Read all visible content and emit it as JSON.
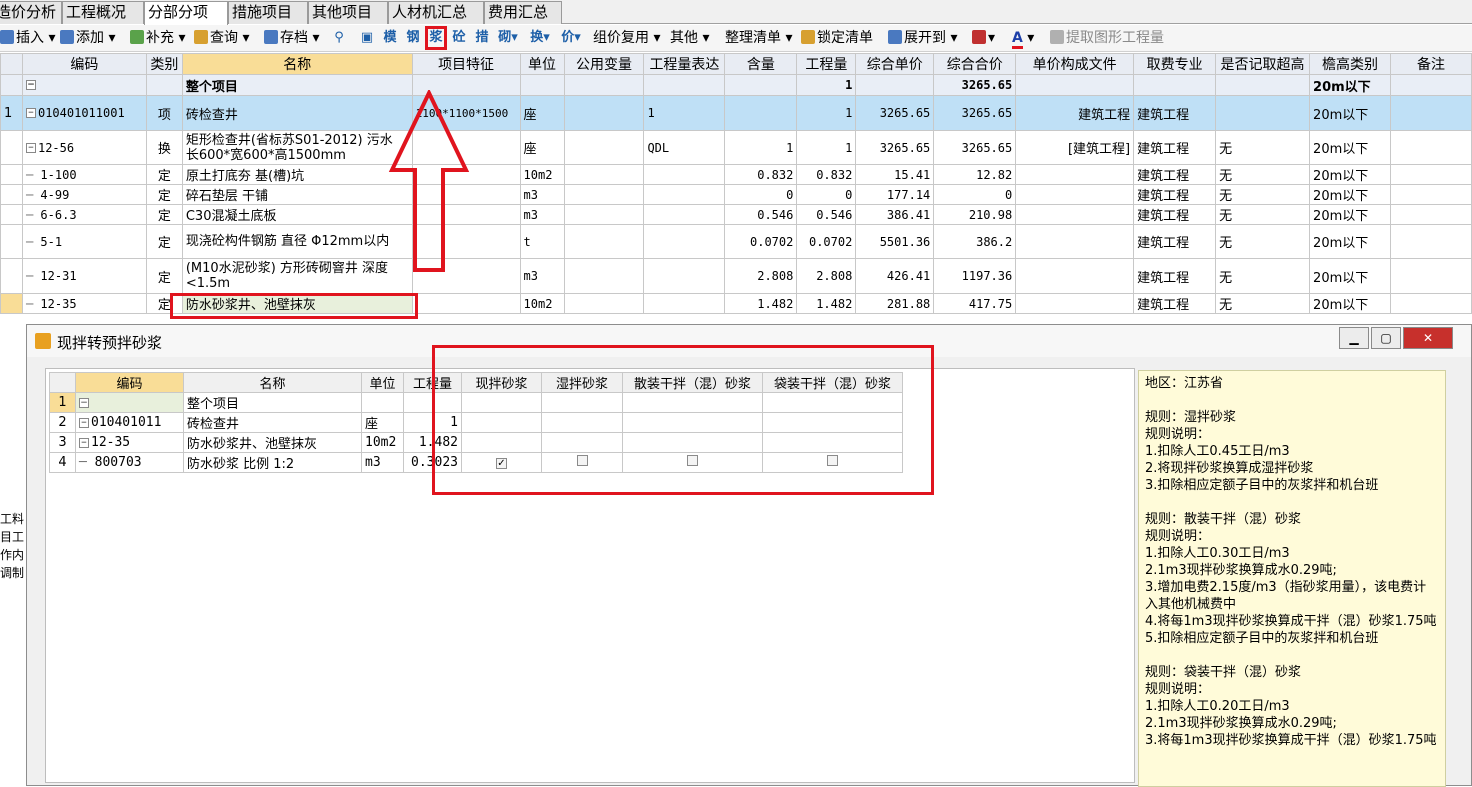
{
  "tabs": [
    "造价分析",
    "工程概况",
    "分部分项",
    "措施项目",
    "其他项目",
    "人材机汇总",
    "费用汇总"
  ],
  "active_tab": 2,
  "toolbar": {
    "insert": "插入",
    "add": "添加",
    "supplement": "补充",
    "query": "查询",
    "save": "存档",
    "template": "模",
    "steel": "钢",
    "mortar": "浆",
    "concrete": "砼",
    "measure": "措",
    "ext": "砌",
    "swap": "换",
    "price": "价",
    "reuse": "组价复用",
    "other": "其他",
    "organize": "整理清单",
    "lock": "锁定清单",
    "expand": "展开到",
    "extract": "提取图形工程量"
  },
  "grid": {
    "headers": [
      "编码",
      "类别",
      "名称",
      "项目特征",
      "单位",
      "公用变量",
      "工程量表达",
      "含量",
      "工程量",
      "综合单价",
      "综合合价",
      "单价构成文件",
      "取费专业",
      "是否记取超高",
      "檐高类别",
      "备注"
    ],
    "rows": [
      {
        "code": "",
        "cat": "",
        "name": "整个项目",
        "feat": "",
        "unit": "",
        "qexpr": "",
        "content": "",
        "qty": "1",
        "uprice": "",
        "total": "3265.65",
        "file": "",
        "fee": "",
        "over": "",
        "height": "20m以下"
      },
      {
        "idx": "1",
        "code": "010401011001",
        "cat": "项",
        "name": "砖检查井",
        "feat": "1100*1100*1500",
        "unit": "座",
        "qexpr": "1",
        "content": "",
        "qty": "1",
        "uprice": "3265.65",
        "total": "3265.65",
        "file": "建筑工程",
        "fee": "建筑工程",
        "over": "",
        "height": "20m以下"
      },
      {
        "code": "12-56",
        "cat": "换",
        "name": "矩形检查井(省标苏S01-2012) 污水 长600*宽600*高1500mm",
        "feat": "",
        "unit": "座",
        "qexpr": "QDL",
        "content": "1",
        "qty": "1",
        "uprice": "3265.65",
        "total": "3265.65",
        "file": "[建筑工程]",
        "fee": "建筑工程",
        "over": "无",
        "height": "20m以下"
      },
      {
        "code": "1-100",
        "cat": "定",
        "name": "原土打底夯 基(槽)坑",
        "feat": "",
        "unit": "10m2",
        "qexpr": "",
        "content": "0.832",
        "qty": "0.832",
        "uprice": "15.41",
        "total": "12.82",
        "file": "",
        "fee": "建筑工程",
        "over": "无",
        "height": "20m以下"
      },
      {
        "code": "4-99",
        "cat": "定",
        "name": "碎石垫层 干铺",
        "feat": "",
        "unit": "m3",
        "qexpr": "",
        "content": "0",
        "qty": "0",
        "uprice": "177.14",
        "total": "0",
        "file": "",
        "fee": "建筑工程",
        "over": "无",
        "height": "20m以下"
      },
      {
        "code": "6-6.3",
        "cat": "定",
        "name": "C30混凝土底板",
        "feat": "",
        "unit": "m3",
        "qexpr": "",
        "content": "0.546",
        "qty": "0.546",
        "uprice": "386.41",
        "total": "210.98",
        "file": "",
        "fee": "建筑工程",
        "over": "无",
        "height": "20m以下"
      },
      {
        "code": "5-1",
        "cat": "定",
        "name": "现浇砼构件钢筋 直径 Φ12mm以内",
        "feat": "",
        "unit": "t",
        "qexpr": "",
        "content": "0.0702",
        "qty": "0.0702",
        "uprice": "5501.36",
        "total": "386.2",
        "file": "",
        "fee": "建筑工程",
        "over": "无",
        "height": "20m以下"
      },
      {
        "code": "12-31",
        "cat": "定",
        "name": "(M10水泥砂浆) 方形砖砌窨井 深度<1.5m",
        "feat": "",
        "unit": "m3",
        "qexpr": "",
        "content": "2.808",
        "qty": "2.808",
        "uprice": "426.41",
        "total": "1197.36",
        "file": "",
        "fee": "建筑工程",
        "over": "无",
        "height": "20m以下"
      },
      {
        "code": "12-35",
        "cat": "定",
        "name": "防水砂浆井、池壁抹灰",
        "feat": "",
        "unit": "10m2",
        "qexpr": "",
        "content": "1.482",
        "qty": "1.482",
        "uprice": "281.88",
        "total": "417.75",
        "file": "",
        "fee": "建筑工程",
        "over": "无",
        "height": "20m以下"
      }
    ]
  },
  "dialog": {
    "title": "现拌转预拌砂浆",
    "headers": [
      "编码",
      "名称",
      "单位",
      "工程量",
      "现拌砂浆",
      "湿拌砂浆",
      "散装干拌（混）砂浆",
      "袋装干拌（混）砂浆"
    ],
    "rows": [
      {
        "n": "1",
        "code": "",
        "name": "整个项目",
        "unit": "",
        "qty": "",
        "c1": false,
        "show": false
      },
      {
        "n": "2",
        "code": "010401011",
        "name": "砖检查井",
        "unit": "座",
        "qty": "1",
        "c1": false,
        "show": false
      },
      {
        "n": "3",
        "code": "12-35",
        "name": "防水砂浆井、池壁抹灰",
        "unit": "10m2",
        "qty": "1.482",
        "c1": false,
        "show": false
      },
      {
        "n": "4",
        "code": "800703",
        "name": "防水砂浆 比例 1:2",
        "unit": "m3",
        "qty": "0.3023",
        "c1": true,
        "show": true
      }
    ],
    "rules": "地区：江苏省\n\n规则：湿拌砂浆\n规则说明：\n1.扣除人工0.45工日/m3\n2.将现拌砂浆换算成湿拌砂浆\n3.扣除相应定额子目中的灰浆拌和机台班\n\n规则：散装干拌（混）砂浆\n规则说明：\n1.扣除人工0.30工日/m3\n2.1m3现拌砂浆换算成水0.29吨;\n3.增加电费2.15度/m3（指砂浆用量），该电费计入其他机械费中\n4.将每1m3现拌砂浆换算成干拌（混）砂浆1.75吨\n5.扣除相应定额子目中的灰浆拌和机台班\n\n规则：袋装干拌（混）砂浆\n规则说明：\n1.扣除人工0.20工日/m3\n2.1m3现拌砂浆换算成水0.29吨;\n3.将每1m3现拌砂浆换算成干拌（混）砂浆1.75吨"
  },
  "left_strip": [
    "工料",
    "目工",
    "作内",
    "调制"
  ],
  "colors": {
    "accent_red": "#e0141e",
    "selected_row": "#bfe0f6",
    "header_selected": "#f9dd97",
    "rules_bg": "#fffbd9"
  }
}
